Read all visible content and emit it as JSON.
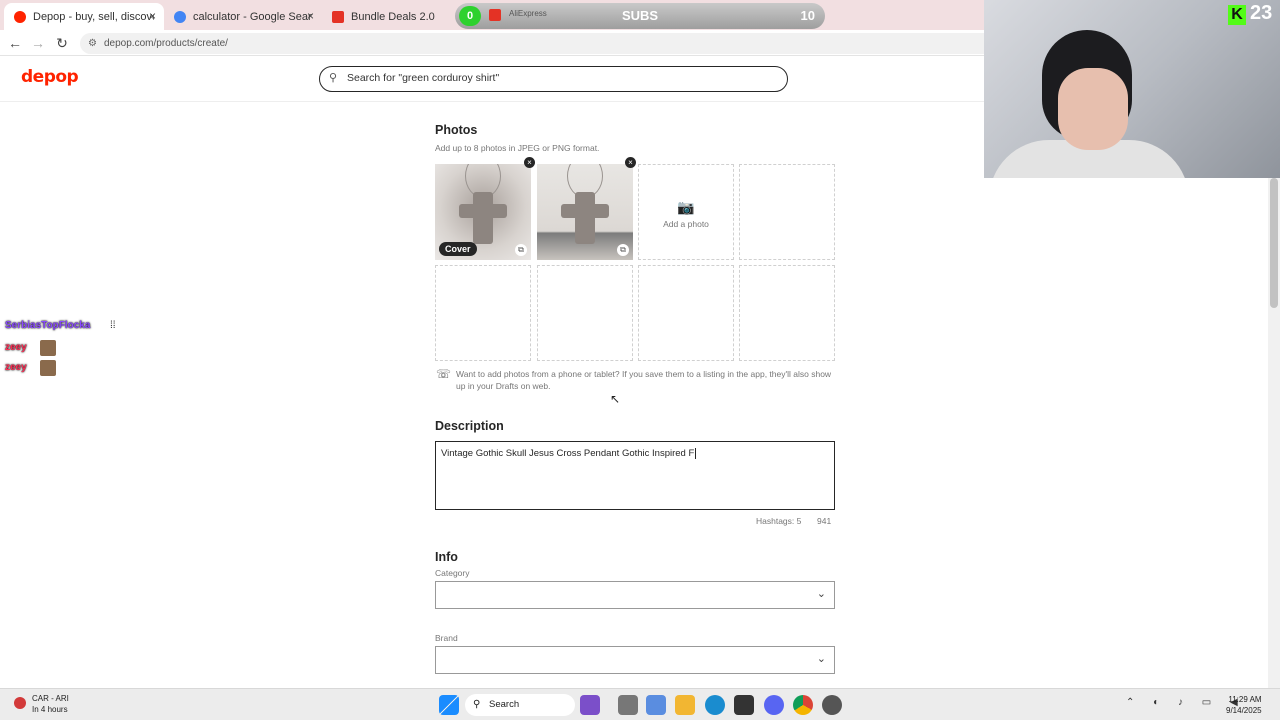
{
  "browser": {
    "tabs": [
      {
        "label": "Depop - buy, sell, discover uniq",
        "favicon_color": "#ff2300",
        "active": true
      },
      {
        "label": "calculator - Google Search",
        "favicon_color": "#4285f4",
        "active": false
      },
      {
        "label": "Bundle Deals 2.0",
        "favicon_color": "#e43225",
        "active": false
      },
      {
        "label": "AliExpress",
        "favicon_color": "#e43225",
        "active": false
      }
    ],
    "close_glyph": "×",
    "url": "depop.com/products/create/",
    "back_icon": "←",
    "forward_icon": "→",
    "reload_icon": "↻"
  },
  "overlay": {
    "subs_current": "0",
    "subs_label": "SUBS",
    "subs_goal": "10",
    "kick_letter": "K",
    "kick_count": "23"
  },
  "site": {
    "logo": "depop",
    "search_placeholder": "Search for \"green corduroy shirt\""
  },
  "photos": {
    "title": "Photos",
    "hint": "Add up to 8 photos in JPEG or PNG format.",
    "cover_label": "Cover",
    "add_label": "Add a photo",
    "app_hint": "Want to add photos from a phone or tablet? If you save them to a listing in the app, they'll also show up in your Drafts on web."
  },
  "description": {
    "title": "Description",
    "value": "Vintage Gothic Skull Jesus Cross Pendant Gothic Inspired F",
    "hashtags": "Hashtags: 5",
    "chars_left": "941"
  },
  "info": {
    "title": "Info",
    "category_label": "Category",
    "brand_label": "Brand",
    "category_value": "",
    "brand_value": ""
  },
  "chat": [
    {
      "user": "SerbiasTopFlocka",
      "color": "#8b4bff"
    },
    {
      "user": "zeey",
      "color": "#ff2d55"
    },
    {
      "user": "zeey",
      "color": "#ff2d55"
    }
  ],
  "taskbar": {
    "weather_title": "CAR - ARI",
    "weather_sub": "In 4 hours",
    "search_label": "Search",
    "time": "11:29 AM",
    "date": "9/14/2025"
  }
}
